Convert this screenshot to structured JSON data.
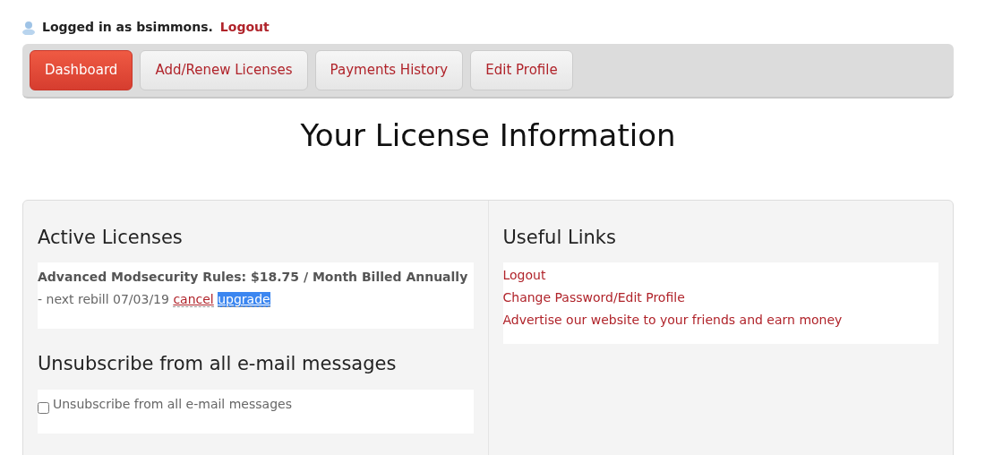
{
  "login": {
    "text": "Logged in as bsimmons.",
    "link": "Logout"
  },
  "tabs": [
    {
      "label": "Dashboard",
      "selected": true
    },
    {
      "label": "Add/Renew Licenses",
      "selected": false
    },
    {
      "label": "Payments History",
      "selected": false
    },
    {
      "label": "Edit Profile",
      "selected": false
    }
  ],
  "title": "Your License Information",
  "active_licenses": {
    "heading": "Active Licenses",
    "text": "**Advanced Modsecurity Rules: $18.75 / Month Billed Annually** - next rebill 07/03/19",
    "links": [
      {
        "label": "cancel",
        "highlighted": false
      },
      {
        "label": "upgrade",
        "highlighted": true
      }
    ]
  },
  "unsubscribe": {
    "heading": "Unsubscribe from all e-mail messages",
    "label": "Unsubscribe from all e-mail messages",
    "checked": false
  },
  "useful_links": {
    "heading": "Useful Links",
    "links": [
      "Logout",
      "Change Password/Edit Profile",
      "Advertise our website to your friends and earn money"
    ]
  }
}
